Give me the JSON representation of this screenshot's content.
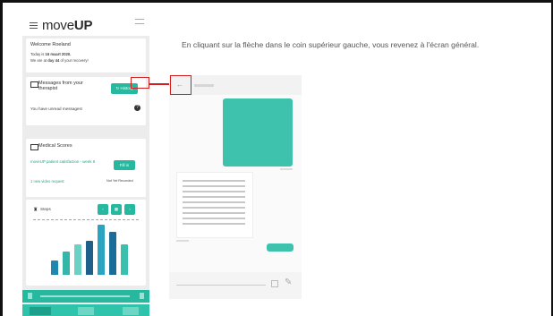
{
  "app": {
    "logo_prefix": "move",
    "logo_suffix": "UP"
  },
  "welcome": {
    "greeting": "Welcome Roeland",
    "today_prefix": "Today is ",
    "today_date": "16 maart 2020.",
    "recovery_prefix": "We are at ",
    "recovery_day": "day 44",
    "recovery_suffix": " of your recovery!"
  },
  "messages": {
    "title": "Messages from your therapist",
    "history_button": "History",
    "unread_text": "You have unread messages!"
  },
  "medical_scores": {
    "title": "Medical Scores",
    "survey_label": "moveUP patient satisfaction - week 6",
    "fill_button": "Fill in",
    "video_label": "1 new video request",
    "video_status": "Not Yet Recorded"
  },
  "steps": {
    "title": "Steps",
    "values": [
      0.25,
      0.42,
      0.55,
      0.62,
      0.9,
      0.78,
      0.55
    ],
    "colors": [
      "#1e88b0",
      "#36b6a8",
      "#6dd0c5",
      "#1f5f8b",
      "#2aa4c0",
      "#1b6d99",
      "#39c1ad"
    ]
  },
  "caption": {
    "text": "En cliquant sur la flèche dans le coin supérieur gauche, vous revenez à l'écran général."
  },
  "colors": {
    "teal": "#27b8a0",
    "highlight": "#d01f1f"
  }
}
